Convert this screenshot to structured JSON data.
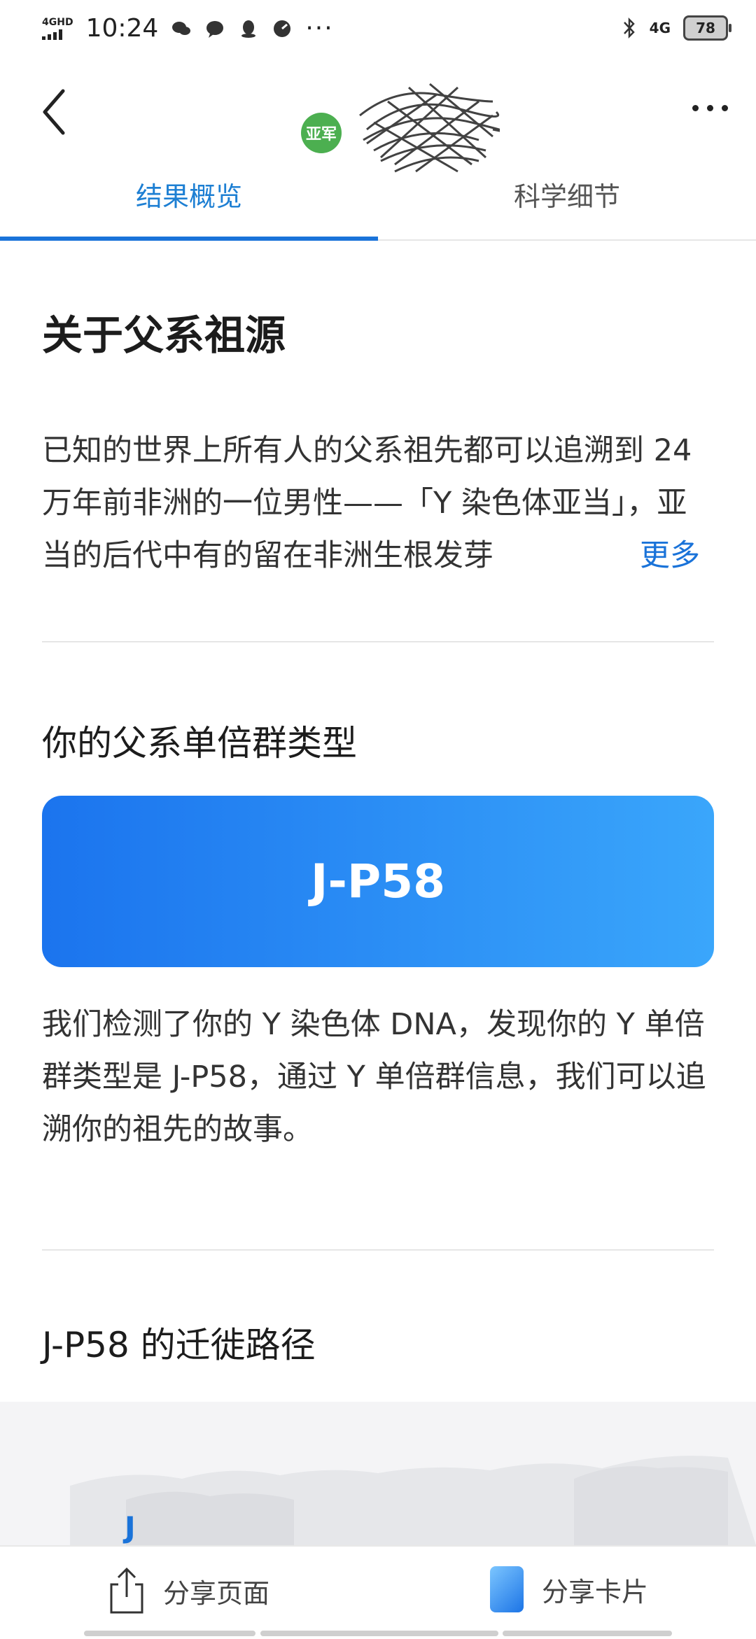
{
  "status_bar": {
    "network_label": "4GHD",
    "time": "10:24",
    "right_network": "4G",
    "battery": "78"
  },
  "nav": {
    "avatar_text": "亚军"
  },
  "tabs": [
    {
      "label": "结果概览",
      "active": true
    },
    {
      "label": "科学细节",
      "active": false
    }
  ],
  "section_paternal": {
    "title": "关于父系祖源",
    "intro": "已知的世界上所有人的父系祖先都可以追溯到 24 万年前非洲的一位男性——「Y 染色体亚当」，亚当的后代中有的留在非洲生根发芽",
    "more_label": "更多"
  },
  "section_haplogroup": {
    "title": "你的父系单倍群类型",
    "haplogroup": "J-P58",
    "description": "我们检测了你的 Y 染色体 DNA，发现你的 Y 单倍群类型是 J-P58，通过 Y 单倍群信息，我们可以追溯你的祖先的故事。"
  },
  "section_migration": {
    "title": "J-P58 的迁徙路径",
    "map_label": "J"
  },
  "bottom_bar": {
    "share_page": "分享页面",
    "share_card": "分享卡片"
  },
  "colors": {
    "accent": "#1a73d9",
    "card_gradient_start": "#1b74ee",
    "card_gradient_end": "#3aa6fb",
    "avatar_bg": "#4caf50"
  }
}
